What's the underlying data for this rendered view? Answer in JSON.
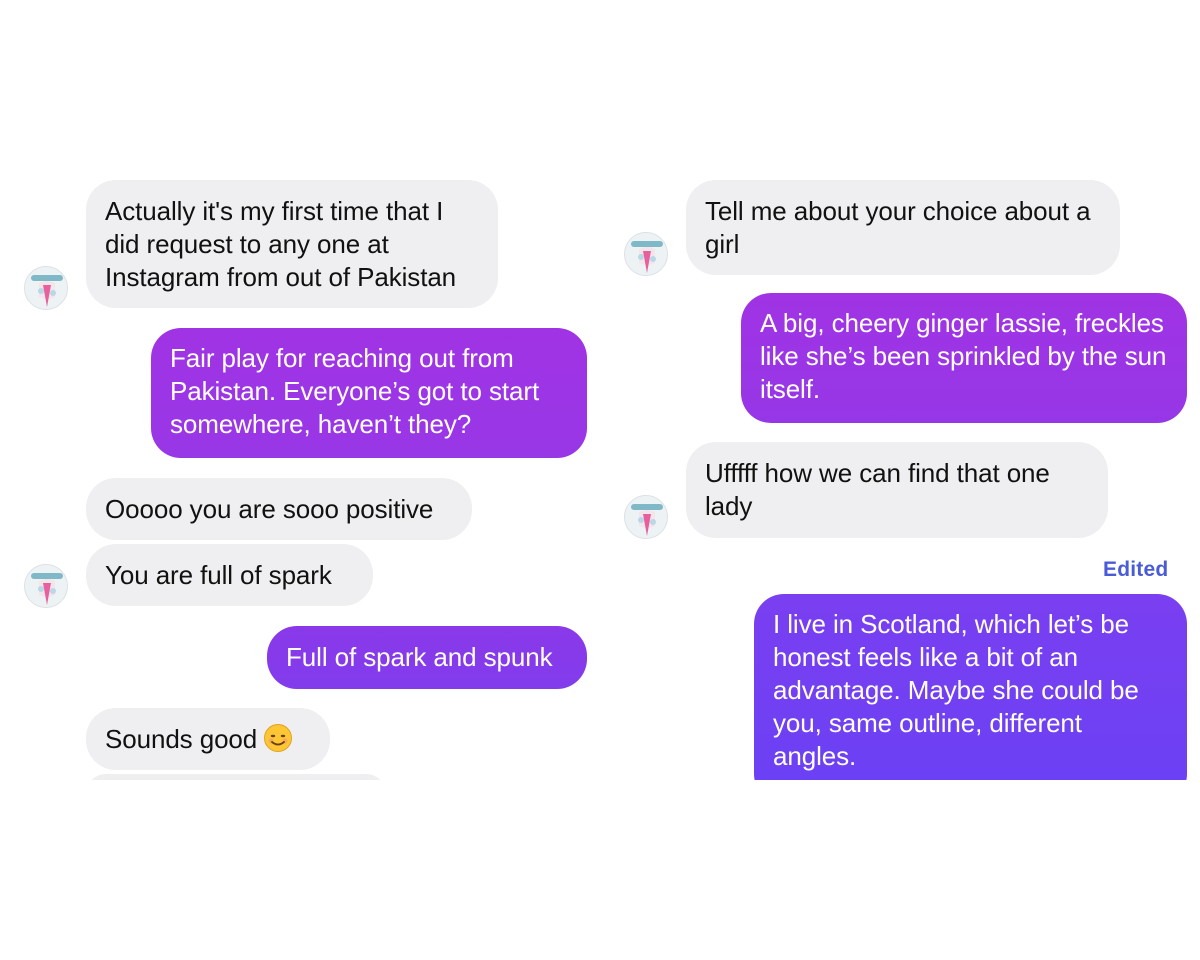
{
  "left": {
    "messages": [
      "Actually it's my first time that I did request to any one at Instagram from out of Pakistan",
      "Fair play for reaching out from Pakistan. Everyone’s got to start somewhere, haven’t they?",
      "Ooooo you are sooo positive",
      "You are  full of spark",
      "Full of spark and spunk",
      "Sounds good"
    ],
    "sounds_good_emoji": "smiling-face-icon"
  },
  "right": {
    "messages": [
      "Tell me about your choice about a girl",
      "A big, cheery ginger lassie, freckles like she’s been sprinkled by the sun itself.",
      "Ufffff how we can find that one lady",
      "I live in Scotland, which let’s be honest feels like a bit of an advantage. Maybe she could be you, same outline, different angles."
    ],
    "edited_label": "Edited"
  },
  "colors": {
    "incoming_bubble": "#efeff1",
    "outgoing_gradient_top": "#a033e4",
    "outgoing_gradient_bottom": "#7a3cf0",
    "edited_label": "#4a5bd8"
  },
  "icons": {
    "avatar": "profile-avatar-icon"
  }
}
